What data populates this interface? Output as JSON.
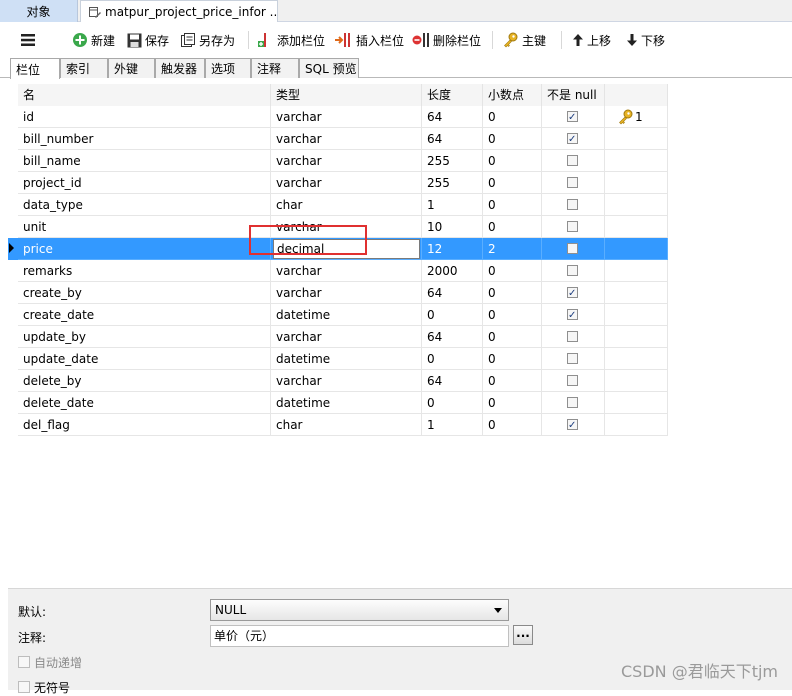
{
  "doc_tabs": {
    "objects": "对象",
    "table": "matpur_project_price_infor ..."
  },
  "toolbar": {
    "new": "新建",
    "save": "保存",
    "save_as": "另存为",
    "add_column": "添加栏位",
    "insert_column": "插入栏位",
    "delete_column": "删除栏位",
    "primary_key": "主键",
    "move_up": "上移",
    "move_down": "下移"
  },
  "subtabs": [
    "栏位",
    "索引",
    "外键",
    "触发器",
    "选项",
    "注释",
    "SQL 预览"
  ],
  "grid": {
    "headers": {
      "name": "名",
      "type": "类型",
      "length": "长度",
      "decimals": "小数点",
      "not_null": "不是 null"
    },
    "rows": [
      {
        "name": "id",
        "type": "varchar",
        "length": "64",
        "decimals": "0",
        "not_null": true,
        "key": "1"
      },
      {
        "name": "bill_number",
        "type": "varchar",
        "length": "64",
        "decimals": "0",
        "not_null": true
      },
      {
        "name": "bill_name",
        "type": "varchar",
        "length": "255",
        "decimals": "0",
        "not_null": false
      },
      {
        "name": "project_id",
        "type": "varchar",
        "length": "255",
        "decimals": "0",
        "not_null": false
      },
      {
        "name": "data_type",
        "type": "char",
        "length": "1",
        "decimals": "0",
        "not_null": false
      },
      {
        "name": "unit",
        "type": "varchar",
        "length": "10",
        "decimals": "0",
        "not_null": false
      },
      {
        "name": "price",
        "type": "decimal",
        "length": "12",
        "decimals": "2",
        "not_null": false,
        "selected": true
      },
      {
        "name": "remarks",
        "type": "varchar",
        "length": "2000",
        "decimals": "0",
        "not_null": false
      },
      {
        "name": "create_by",
        "type": "varchar",
        "length": "64",
        "decimals": "0",
        "not_null": true
      },
      {
        "name": "create_date",
        "type": "datetime",
        "length": "0",
        "decimals": "0",
        "not_null": true
      },
      {
        "name": "update_by",
        "type": "varchar",
        "length": "64",
        "decimals": "0",
        "not_null": false
      },
      {
        "name": "update_date",
        "type": "datetime",
        "length": "0",
        "decimals": "0",
        "not_null": false
      },
      {
        "name": "delete_by",
        "type": "varchar",
        "length": "64",
        "decimals": "0",
        "not_null": false
      },
      {
        "name": "delete_date",
        "type": "datetime",
        "length": "0",
        "decimals": "0",
        "not_null": false
      },
      {
        "name": "del_flag",
        "type": "char",
        "length": "1",
        "decimals": "0",
        "not_null": true
      }
    ]
  },
  "bottom": {
    "default_label": "默认:",
    "default_value": "NULL",
    "comment_label": "注释:",
    "comment_value": "单价（元）",
    "ellipsis": "...",
    "auto_increment": "自动递增",
    "unsigned": "无符号"
  },
  "watermark": "CSDN @君临天下tjm",
  "colors": {
    "selection": "#3399ff",
    "highlight_box": "#e03030",
    "tab_blue": "#cfe0f5"
  }
}
